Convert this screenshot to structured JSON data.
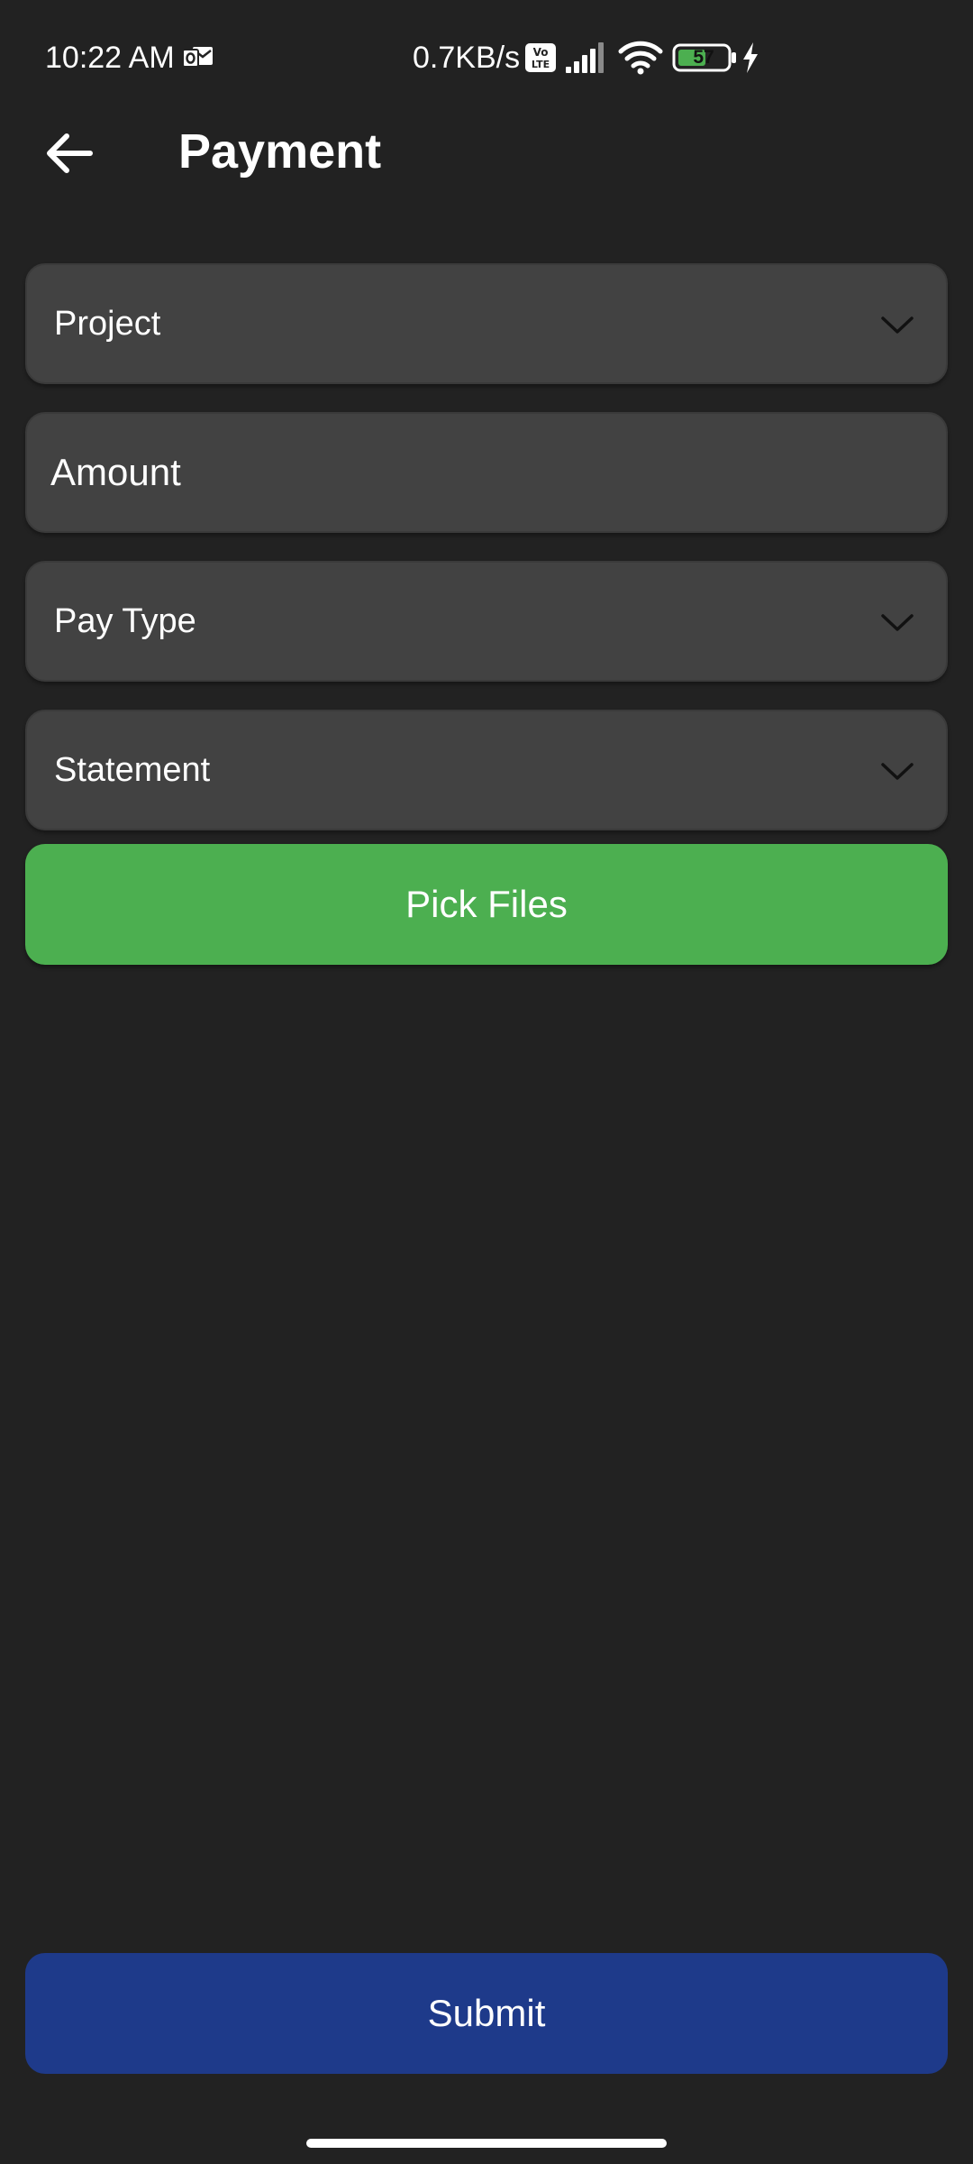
{
  "status_bar": {
    "time": "10:22 AM",
    "network_speed": "0.7KB/s",
    "battery_level": "57",
    "icons": [
      "outlook-notification-icon",
      "volte-icon",
      "signal-icon",
      "wifi-icon",
      "battery-icon",
      "charging-icon"
    ]
  },
  "app_bar": {
    "title": "Payment",
    "back_icon": "arrow-left-icon"
  },
  "form": {
    "project": {
      "label": "Project",
      "icon": "chevron-down-icon"
    },
    "amount": {
      "placeholder": "Amount"
    },
    "pay_type": {
      "label": "Pay Type",
      "icon": "chevron-down-icon"
    },
    "statement": {
      "label": "Statement",
      "icon": "chevron-down-icon"
    },
    "pick_files_label": "Pick Files",
    "submit_label": "Submit"
  },
  "colors": {
    "background": "#222222",
    "field_background": "#424242",
    "pick_files_button": "#4caf50",
    "submit_button": "#1e3a8a"
  }
}
